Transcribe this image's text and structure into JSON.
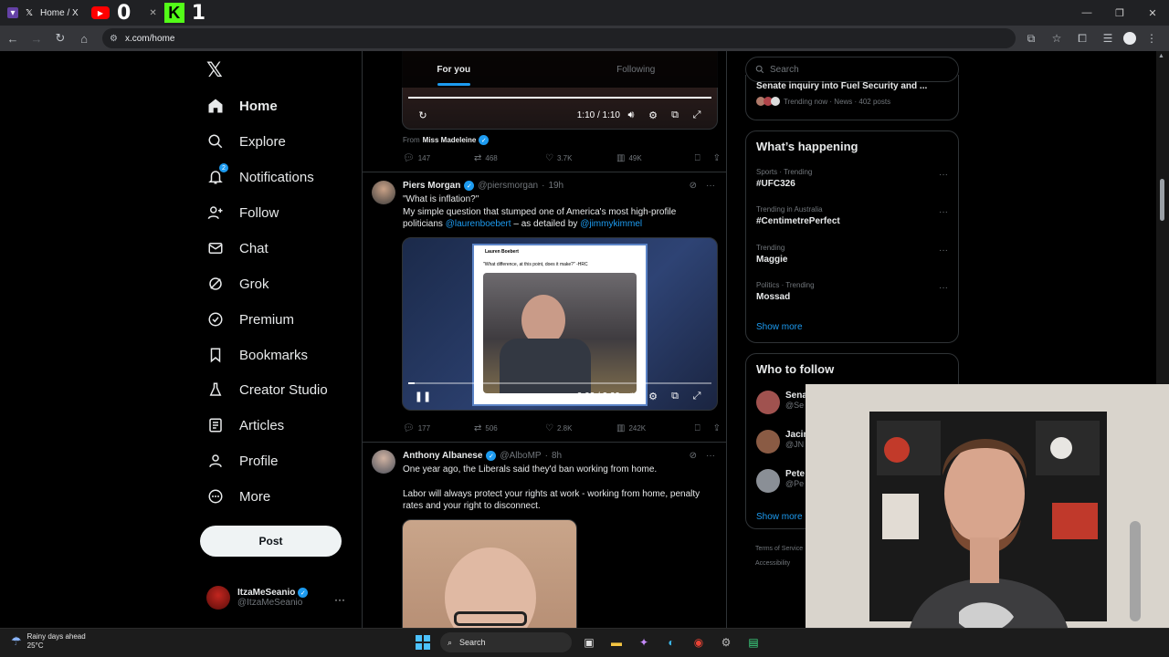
{
  "browser": {
    "tab_title": "Home / X",
    "overlay_counter_a": "0",
    "overlay_counter_b": "1",
    "url": "x.com/home"
  },
  "nav": {
    "items": [
      {
        "label": "Home",
        "icon": "home-icon"
      },
      {
        "label": "Explore",
        "icon": "search-icon"
      },
      {
        "label": "Notifications",
        "icon": "bell-icon"
      },
      {
        "label": "Follow",
        "icon": "person-add-icon"
      },
      {
        "label": "Chat",
        "icon": "mail-icon"
      },
      {
        "label": "Grok",
        "icon": "grok-icon"
      },
      {
        "label": "Premium",
        "icon": "verified-icon"
      },
      {
        "label": "Bookmarks",
        "icon": "bookmark-icon"
      },
      {
        "label": "Creator Studio",
        "icon": "creator-icon"
      },
      {
        "label": "Articles",
        "icon": "article-icon"
      },
      {
        "label": "Profile",
        "icon": "person-icon"
      },
      {
        "label": "More",
        "icon": "more-circle-icon"
      }
    ],
    "notification_badge": "2",
    "post_label": "Post",
    "account": {
      "name": "ItzaMeSeanio",
      "handle": "@ItzaMeSeanio"
    }
  },
  "timeline": {
    "tabs": [
      "For you",
      "Following"
    ],
    "prev_tweet": {
      "video_time": "1:10 / 1:10",
      "from_prefix": "From",
      "from_name": "Miss Madeleine",
      "replies": "147",
      "reposts": "468",
      "likes": "3.7K",
      "views": "49K"
    },
    "tweet1": {
      "name": "Piers Morgan",
      "handle": "@piersmorgan",
      "time": "19h",
      "line1": "\"What is inflation?\"",
      "line2": "My simple question that stumped one of America's most high-profile",
      "line3_a": "politicians",
      "mention1": "@laurenboebert",
      "line3_b": "– as detailed by",
      "mention2": "@jimmykimmel",
      "embed_name": "Lauren Boebert",
      "embed_quote": "\"What difference, at this point, does it make?\" -HRC",
      "video_time": "0:02 / 2:29",
      "progress": 0.02,
      "replies": "177",
      "reposts": "506",
      "likes": "2.8K",
      "views": "242K"
    },
    "tweet2": {
      "name": "Anthony Albanese",
      "handle": "@AlboMP",
      "time": "8h",
      "line1": "One year ago, the Liberals said they'd ban working from home.",
      "line2": "Labor will always protect your rights at work - working from home, penalty",
      "line3": "rates and your right to disconnect."
    }
  },
  "right": {
    "search_placeholder": "Search",
    "top_card": {
      "title": "Senate inquiry into Fuel Security and ...",
      "meta": "Trending now · News · 402 posts"
    },
    "happening": {
      "title": "What’s happening",
      "trends": [
        {
          "meta": "Sports · Trending",
          "title": "#UFC326"
        },
        {
          "meta": "Trending in Australia",
          "title": "#CentimetrePerfect"
        },
        {
          "meta": "Trending",
          "title": "Maggie"
        },
        {
          "meta": "Politics · Trending",
          "title": "Mossad"
        }
      ],
      "show_more": "Show more"
    },
    "who_to_follow": {
      "title": "Who to follow",
      "people": [
        {
          "name": "Sena",
          "handle": "@Se"
        },
        {
          "name": "Jacin",
          "handle": "@JN"
        },
        {
          "name": "Pete",
          "handle": "@Pe"
        }
      ],
      "show_more": "Show more"
    },
    "footer": [
      "Terms of Service",
      "Accessibility"
    ]
  },
  "taskbar": {
    "weather_title": "Rainy days ahead",
    "weather_temp": "25°C",
    "search": "Search"
  }
}
